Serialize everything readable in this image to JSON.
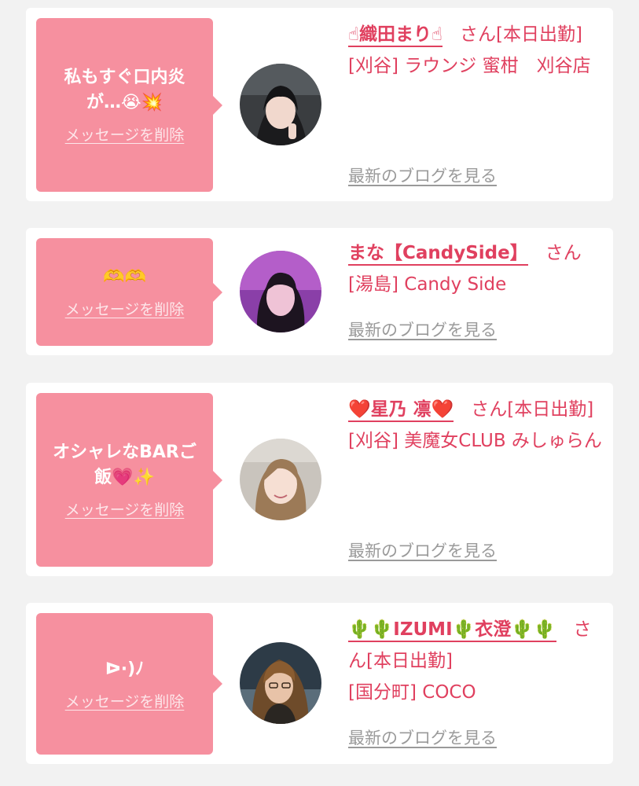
{
  "cards": [
    {
      "message": "私もすぐ口内炎が…😭💥",
      "delete_label": "メッセージを削除",
      "name": "☝織田まり☝",
      "honorific": "さん",
      "status": "[本日出勤]",
      "shop": "[刈谷] ラウンジ 蜜柑　刈谷店",
      "blog_label": "最新のブログを見る"
    },
    {
      "message": "🫶🫶",
      "delete_label": "メッセージを削除",
      "name": "まな【CandySide】",
      "honorific": "さん",
      "status": "",
      "shop": "[湯島] Candy Side",
      "blog_label": "最新のブログを見る"
    },
    {
      "message": "オシャレなBARご飯💗✨",
      "delete_label": "メッセージを削除",
      "name": "❤️星乃 凛❤️",
      "honorific": "さん",
      "status": "[本日出勤]",
      "shop": "[刈谷] 美魔女CLUB みしゅらん",
      "blog_label": "最新のブログを見る"
    },
    {
      "message": "ᐅ·)ﾉ",
      "delete_label": "メッセージを削除",
      "name": "🌵🌵IZUMI🌵衣澄🌵🌵",
      "honorific": "さん",
      "status": "[本日出勤]",
      "shop": "[国分町] COCO",
      "blog_label": "最新のブログを見る"
    }
  ],
  "colors": {
    "bubble": "#f6909f",
    "accent": "#e0405f",
    "link_gray": "#9a9a9a",
    "background": "#f2f2f2"
  }
}
